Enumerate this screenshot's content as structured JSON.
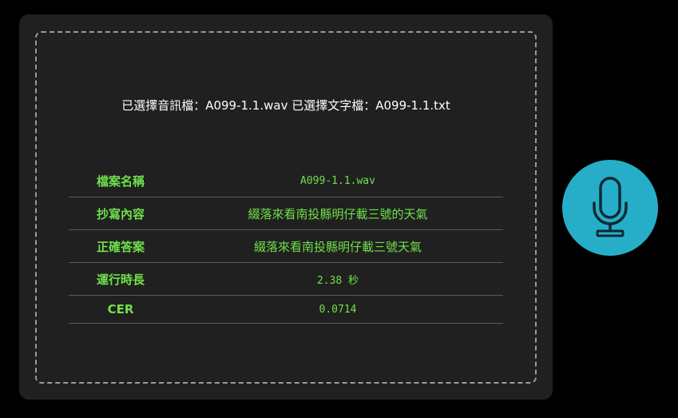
{
  "upload": {
    "selected_text": "已選擇音訊檔：A099-1.1.wav 已選擇文字檔：A099-1.1.txt"
  },
  "results": {
    "rows": [
      {
        "label": "檔案名稱",
        "value": "A099-1.1.wav"
      },
      {
        "label": "抄寫內容",
        "value": "綴落來看南投縣明仔載三號的天氣"
      },
      {
        "label": "正確答案",
        "value": "綴落來看南投縣明仔載三號天氣"
      },
      {
        "label": "運行時長",
        "value": "2.38 秒"
      },
      {
        "label": "CER",
        "value": "0.0714"
      }
    ]
  },
  "mic": {
    "icon": "microphone-icon",
    "color": "#26aec8"
  },
  "colors": {
    "accent_text": "#6fe04a",
    "panel_bg": "#202020",
    "page_bg": "#000000"
  }
}
